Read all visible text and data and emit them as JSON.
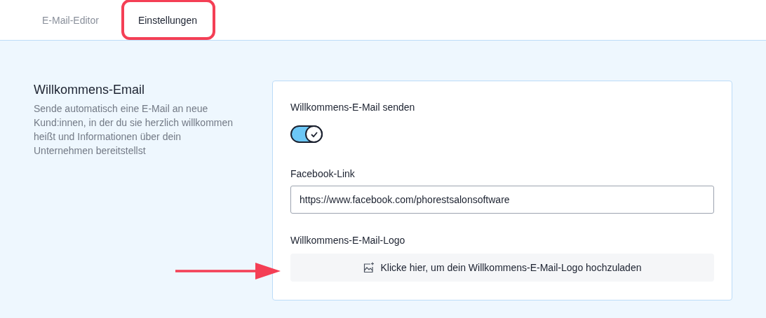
{
  "tabs": [
    {
      "label": "E-Mail-Editor",
      "selected": false,
      "highlighted": false
    },
    {
      "label": "Einstellungen",
      "selected": true,
      "highlighted": true
    }
  ],
  "section": {
    "title": "Willkommens-Email",
    "description": "Sende automatisch eine E-Mail an neue Kund:innen, in der du sie herzlich willkommen heißt und Informationen über dein Unternehmen bereitstellst"
  },
  "card": {
    "toggle": {
      "label": "Willkommens-E-Mail senden",
      "on": true
    },
    "facebook": {
      "label": "Facebook-Link",
      "value": "https://www.facebook.com/phorestsalonsoftware"
    },
    "logo": {
      "label": "Willkommens-E-Mail-Logo",
      "upload": "Klicke hier, um dein Willkommens-E-Mail-Logo hochzuladen"
    }
  },
  "annotations": {
    "arrow": true
  }
}
